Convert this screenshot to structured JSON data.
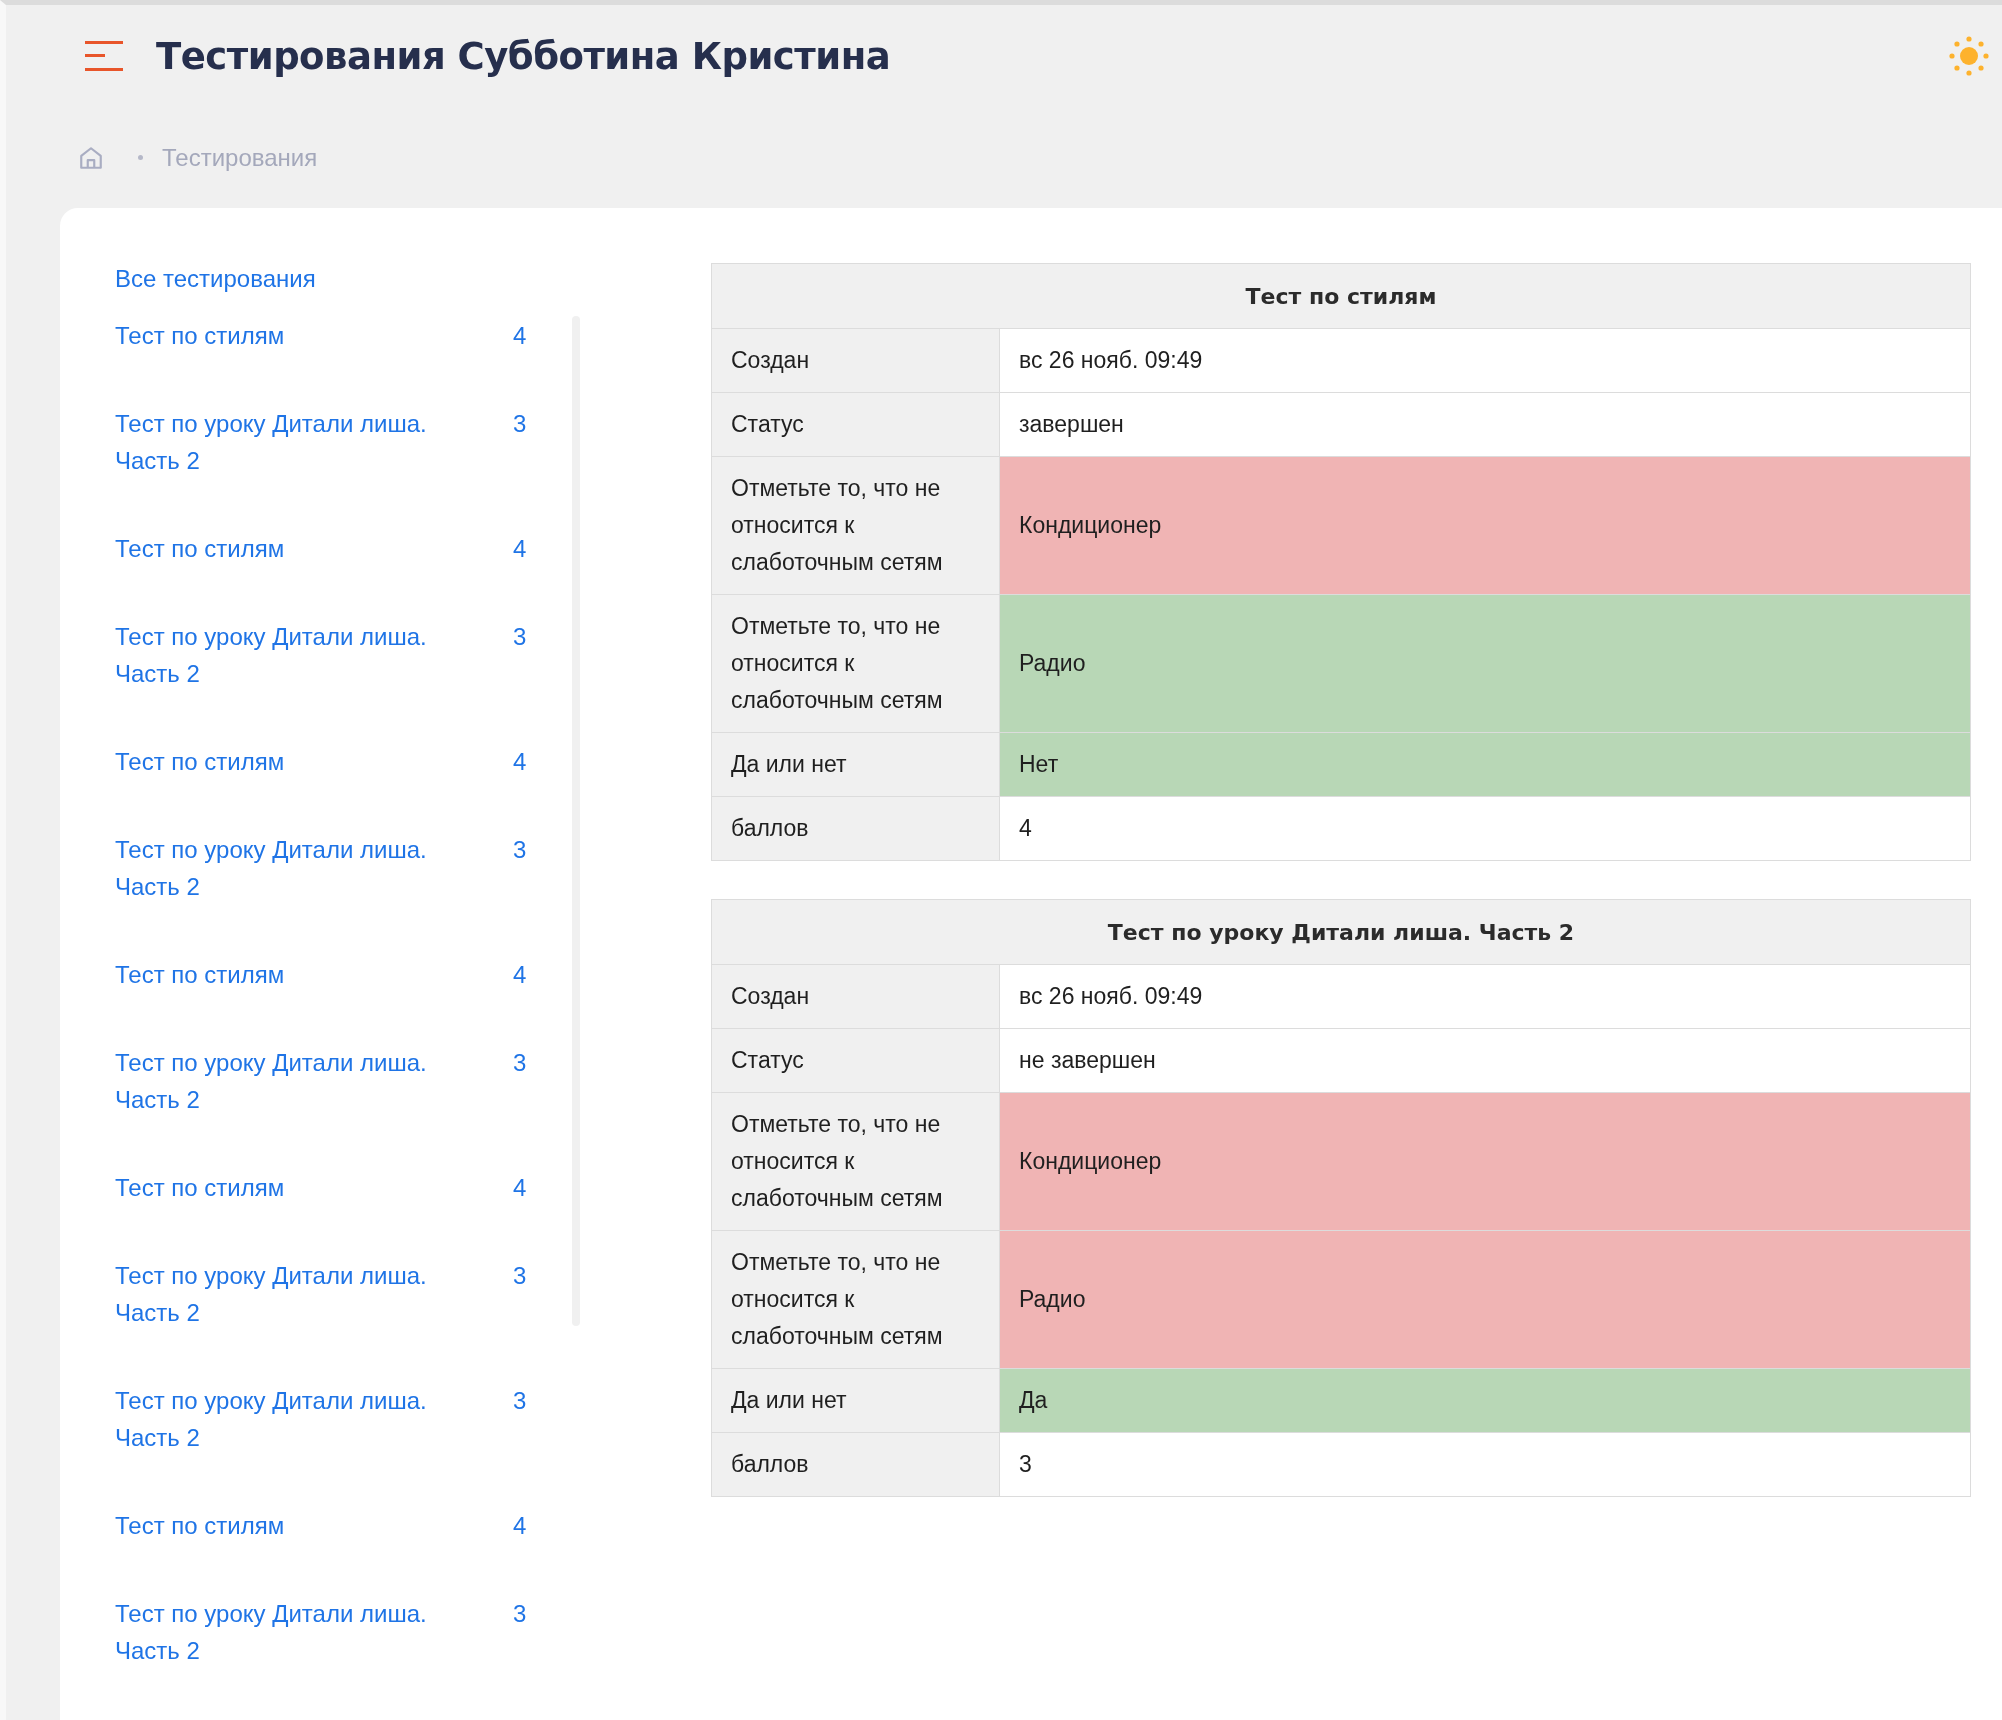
{
  "header": {
    "title": "Тестирования Субботина Кристина"
  },
  "breadcrumb": {
    "items": [
      "Тестирования"
    ]
  },
  "sidebar": {
    "all_link": "Все тестирования",
    "items": [
      {
        "title": "Тест по стилям",
        "count": "4"
      },
      {
        "title": "Тест по уроку Дитали лиша. Часть 2",
        "count": "3"
      },
      {
        "title": "Тест по стилям",
        "count": "4"
      },
      {
        "title": "Тест по уроку Дитали лиша. Часть 2",
        "count": "3"
      },
      {
        "title": "Тест по стилям",
        "count": "4"
      },
      {
        "title": "Тест по уроку Дитали лиша. Часть 2",
        "count": "3"
      },
      {
        "title": "Тест по стилям",
        "count": "4"
      },
      {
        "title": "Тест по уроку Дитали лиша. Часть 2",
        "count": "3"
      },
      {
        "title": "Тест по стилям",
        "count": "4"
      },
      {
        "title": "Тест по уроку Дитали лиша. Часть 2",
        "count": "3"
      },
      {
        "title": "Тест по уроку Дитали лиша. Часть 2",
        "count": "3"
      },
      {
        "title": "Тест по стилям",
        "count": "4"
      },
      {
        "title": "Тест по уроку Дитали лиша. Часть 2",
        "count": "3"
      }
    ]
  },
  "results": [
    {
      "title": "Тест по стилям",
      "rows": [
        {
          "kind": "info",
          "label": "Создан",
          "value": "вс 26 нояб. 09:49"
        },
        {
          "kind": "info",
          "label": "Статус",
          "value": "завершен"
        },
        {
          "kind": "answer",
          "label": "Отметьте то, что не относится к слаботочным сетям",
          "value": "Кондиционер",
          "correct": false
        },
        {
          "kind": "answer",
          "label": "Отметьте то, что не относится к слаботочным сетям",
          "value": "Радио",
          "correct": true
        },
        {
          "kind": "answer",
          "label": "Да или нет",
          "value": "Нет",
          "correct": true
        },
        {
          "kind": "info",
          "label": "баллов",
          "value": "4"
        }
      ]
    },
    {
      "title": "Тест по уроку Дитали лиша. Часть 2",
      "rows": [
        {
          "kind": "info",
          "label": "Создан",
          "value": "вс 26 нояб. 09:49"
        },
        {
          "kind": "info",
          "label": "Статус",
          "value": "не завершен"
        },
        {
          "kind": "answer",
          "label": "Отметьте то, что не относится к слаботочным сетям",
          "value": "Кондиционер",
          "correct": false
        },
        {
          "kind": "answer",
          "label": "Отметьте то, что не относится к слаботочным сетям",
          "value": "Радио",
          "correct": false
        },
        {
          "kind": "answer",
          "label": "Да или нет",
          "value": "Да",
          "correct": true
        },
        {
          "kind": "info",
          "label": "баллов",
          "value": "3"
        }
      ]
    }
  ]
}
